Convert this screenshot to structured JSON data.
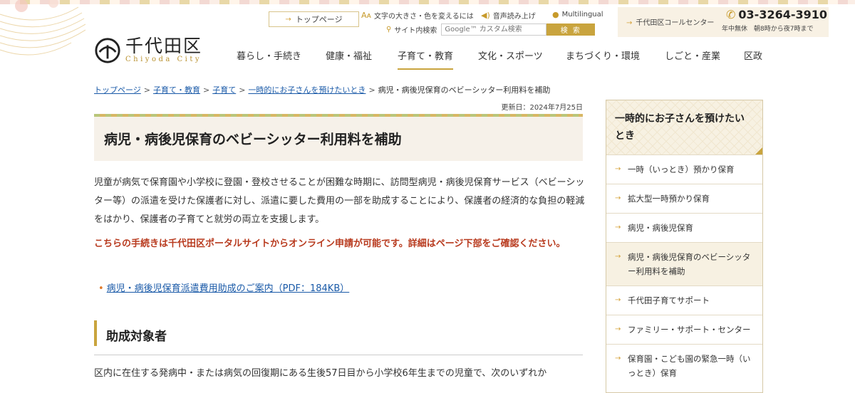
{
  "header": {
    "logo_ja": "千代田区",
    "logo_en": "Chiyoda City",
    "top_page_label": "トップページ",
    "util_font": "文字の大きさ・色を変えるには",
    "util_voice": "音声読み上げ",
    "util_lang": "Multilingual",
    "search_label": "サイト内検索",
    "search_placeholder": "Google™ カスタム検索",
    "search_button": "検 索",
    "call_label": "千代田区コールセンター",
    "call_number": "03-3264-3910",
    "call_hours": "年中無休　朝8時から夜7時まで"
  },
  "nav": {
    "items": [
      {
        "label": "暮らし・手続き"
      },
      {
        "label": "健康・福祉"
      },
      {
        "label": "子育て・教育"
      },
      {
        "label": "文化・スポーツ"
      },
      {
        "label": "まちづくり・環境"
      },
      {
        "label": "しごと・産業"
      },
      {
        "label": "区政"
      }
    ]
  },
  "breadcrumb": {
    "items": [
      {
        "label": "トップページ"
      },
      {
        "label": "子育て・教育"
      },
      {
        "label": "子育て"
      },
      {
        "label": "一時的にお子さんを預けたいとき"
      },
      {
        "label": "病児・病後児保育のベビーシッター利用料を補助"
      }
    ],
    "sep": ">"
  },
  "page": {
    "updated": "更新日：2024年7月25日",
    "title": "病児・病後児保育のベビーシッター利用料を補助",
    "intro": "児童が病気で保育園や小学校に登園・登校させることが困難な時期に、訪問型病児・病後児保育サービス（ベビーシッター等）の派遣を受けた保護者に対し、派遣に要した費用の一部を助成することにより、保護者の経済的な負担の軽減をはかり、保護者の子育てと就労の両立を支援します。",
    "alert": "こちらの手続きは千代田区ポータルサイトからオンライン申請が可能です。詳細はページ下部をご確認ください。",
    "pdf_link": "病児・病後児保育派遣費用助成のご案内（PDF：184KB）",
    "section_title": "助成対象者",
    "section_text": "区内に在住する発病中・または病気の回復期にある生後57日目から小学校6年生までの児童で、次のいずれか"
  },
  "sidebar": {
    "title": "一時的にお子さんを預けたいとき",
    "items": [
      {
        "label": "一時（いっとき）預かり保育"
      },
      {
        "label": "拡大型一時預かり保育"
      },
      {
        "label": "病児・病後児保育"
      },
      {
        "label": "病児・病後児保育のベビーシッター利用料を補助"
      },
      {
        "label": "千代田子育てサポート"
      },
      {
        "label": "ファミリー・サポート・センター"
      },
      {
        "label": "保育園・こども園の緊急一時（いっとき）保育"
      }
    ]
  },
  "colors": {
    "accent_gold": "#c9a43e",
    "link_blue": "#1a5aa8",
    "alert_red": "#b83a1e"
  }
}
